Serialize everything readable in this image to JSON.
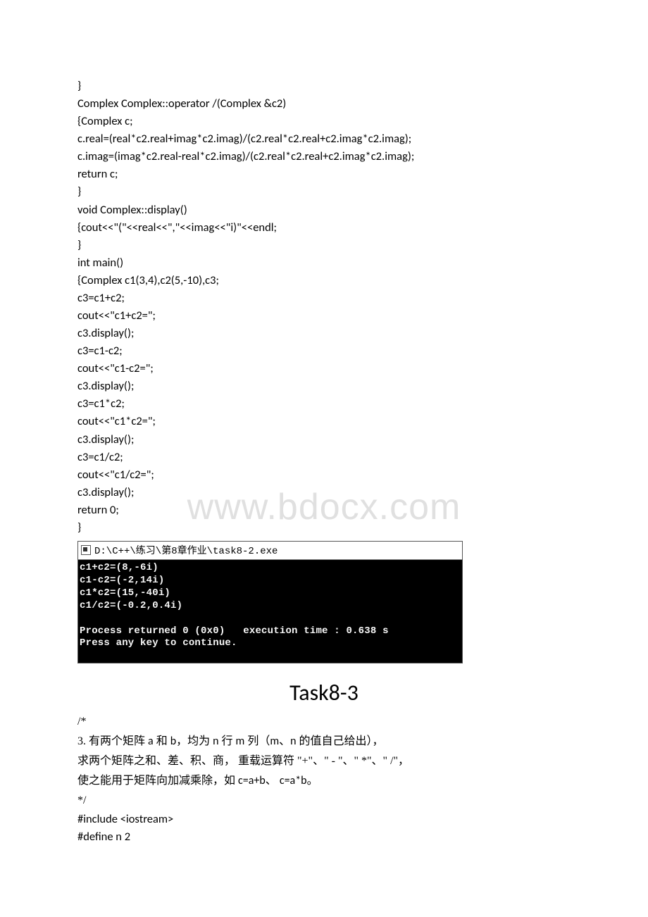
{
  "watermark": "www.bdocx.com",
  "code_lines": [
    "}",
    "Complex Complex::operator /(Complex &c2)",
    "{Complex c;",
    "c.real=(real*c2.real+imag*c2.imag)/(c2.real*c2.real+c2.imag*c2.imag);",
    "c.imag=(imag*c2.real-real*c2.imag)/(c2.real*c2.real+c2.imag*c2.imag);",
    "return c;",
    "}",
    "void Complex::display()",
    "{cout<<\"(\"<<real<<\",\"<<imag<<\"i)\"<<endl;",
    "}",
    "int main()",
    "{Complex c1(3,4),c2(5,-10),c3;",
    "c3=c1+c2;",
    "cout<<\"c1+c2=\";",
    "c3.display();",
    "c3=c1-c2;",
    "cout<<\"c1-c2=\";",
    "c3.display();",
    "c3=c1*c2;",
    "cout<<\"c1*c2=\";",
    "c3.display();",
    "c3=c1/c2;",
    "cout<<\"c1/c2=\";",
    "c3.display();",
    "return 0;",
    "}"
  ],
  "console": {
    "title": "D:\\C++\\练习\\第8章作业\\task8-2.exe",
    "lines": [
      "c1+c2=(8,-6i)",
      "c1-c2=(-2,14i)",
      "c1*c2=(15,-40i)",
      "c1/c2=(-0.2,0.4i)",
      "",
      "Process returned 0 (0x0)   execution time : 0.638 s",
      "Press any key to continue."
    ]
  },
  "heading": "Task8-3",
  "task_desc": {
    "l1": "/*",
    "l2_pre": "3.    有两个矩阵 ",
    "l2_a": "a",
    "l2_mid1": " 和 ",
    "l2_b": "b",
    "l2_mid2": "，均为 ",
    "l2_n": "n",
    "l2_mid3": " 行 ",
    "l2_m": "m",
    "l2_mid4": " 列（",
    "l2_mn": "m、n",
    "l2_end": " 的值自己给出），",
    "l3": "求两个矩阵之和、差、积、商，  重载运算符 \"+\"、\" - \"、\" *\"、\" /\"，",
    "l4_pre": "使之能用于矩阵向加减乘除，如 ",
    "l4_eq1": "c=a+b",
    "l4_mid": "、  ",
    "l4_eq2": "c=a*b",
    "l4_end": "。",
    "l5": "*/",
    "l6": "#include <iostream>",
    "l7": "#define n 2"
  }
}
